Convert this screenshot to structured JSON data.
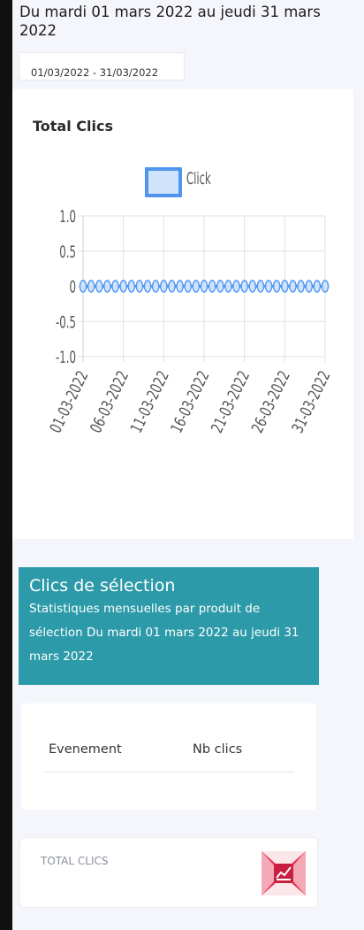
{
  "header": {
    "subtitle": "Du mardi 01 mars 2022 au jeudi 31 mars 2022",
    "date_range_value": "01/03/2022 - 31/03/2022"
  },
  "chart_card": {
    "title": "Total Clics"
  },
  "chart_data": {
    "type": "line",
    "title": "",
    "xlabel": "",
    "ylabel": "",
    "legend": {
      "labels": [
        "Click"
      ],
      "placement": "top-center"
    },
    "x": [
      "01-03-2022",
      "02-03-2022",
      "03-03-2022",
      "04-03-2022",
      "05-03-2022",
      "06-03-2022",
      "07-03-2022",
      "08-03-2022",
      "09-03-2022",
      "10-03-2022",
      "11-03-2022",
      "12-03-2022",
      "13-03-2022",
      "14-03-2022",
      "15-03-2022",
      "16-03-2022",
      "17-03-2022",
      "18-03-2022",
      "19-03-2022",
      "20-03-2022",
      "21-03-2022",
      "22-03-2022",
      "23-03-2022",
      "24-03-2022",
      "25-03-2022",
      "26-03-2022",
      "27-03-2022",
      "28-03-2022",
      "29-03-2022",
      "30-03-2022",
      "31-03-2022"
    ],
    "x_tick_labels": [
      "01-03-2022",
      "06-03-2022",
      "11-03-2022",
      "16-03-2022",
      "21-03-2022",
      "26-03-2022",
      "31-03-2022"
    ],
    "series": [
      {
        "name": "Click",
        "values": [
          0,
          0,
          0,
          0,
          0,
          0,
          0,
          0,
          0,
          0,
          0,
          0,
          0,
          0,
          0,
          0,
          0,
          0,
          0,
          0,
          0,
          0,
          0,
          0,
          0,
          0,
          0,
          0,
          0,
          0,
          0
        ]
      }
    ],
    "y_ticks": [
      "1.0",
      "0.5",
      "0",
      "-0.5",
      "-1.0"
    ],
    "ylim": [
      -1,
      1
    ],
    "grid": true,
    "colors": {
      "line": "#4f95f0",
      "fill": "#cfe3fb"
    }
  },
  "banner": {
    "title": "Clics de sélection",
    "description": "Statistiques mensuelles par produit de sélection Du mardi 01 mars 2022 au jeudi 31 mars 2022",
    "color": "#2c9aa8"
  },
  "table": {
    "columns": [
      "Evenement",
      "Nb clics"
    ],
    "rows": []
  },
  "stat_card": {
    "label": "TOTAL CLICS",
    "icon": "chart-icon",
    "icon_color": "#e8324f"
  }
}
